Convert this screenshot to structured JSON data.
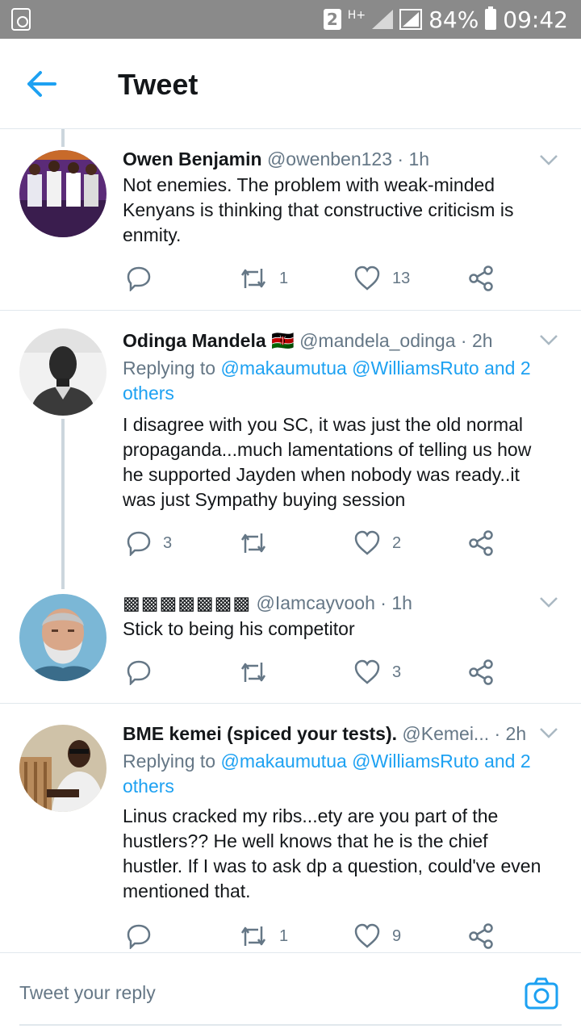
{
  "status_bar": {
    "sim": "2",
    "network": "H+",
    "battery": "84%",
    "time": "09:42"
  },
  "header": {
    "title": "Tweet"
  },
  "tweets": [
    {
      "name": "Owen Benjamin",
      "handle": "@owenben123",
      "time": "· 1h",
      "text": "Not enemies. The problem with weak-minded Kenyans is thinking that constructive criticism is enmity.",
      "replies": "",
      "retweets": "1",
      "likes": "13"
    },
    {
      "name": "Odinga Mandela",
      "flag": "🇰🇪",
      "handle": "@mandela_odinga",
      "time": "· 2h",
      "replying_prefix": "Replying to",
      "replying_targets": "@makaumutua @WilliamsRuto and 2 others",
      "text": "I disagree with you SC, it was just the old normal propaganda...much lamentations of telling us how he supported Jayden when nobody was ready..it was just Sympathy buying session",
      "replies": "3",
      "retweets": "",
      "likes": "2"
    },
    {
      "name": "▩▩▩▩▩▩▩",
      "handle": "@Iamcayvooh",
      "time": "· 1h",
      "text": "Stick to being his competitor",
      "replies": "",
      "retweets": "",
      "likes": "3"
    },
    {
      "name": "BME kemei (spiced your tests).",
      "handle": "@Kemei...",
      "time": "· 2h",
      "replying_prefix": "Replying to",
      "replying_targets": "@makaumutua @WilliamsRuto and 2 others",
      "text": "Linus cracked my ribs...ety are you part of the hustlers?? He well knows that he is the chief hustler. If I was to ask dp a question, could've even mentioned that.",
      "replies": "",
      "retweets": "1",
      "likes": "9"
    }
  ],
  "reply_box": {
    "placeholder": "Tweet your reply"
  },
  "colors": {
    "accent": "#1da1f2",
    "muted": "#657786",
    "text": "#14171a",
    "border": "#e1e8ed"
  }
}
